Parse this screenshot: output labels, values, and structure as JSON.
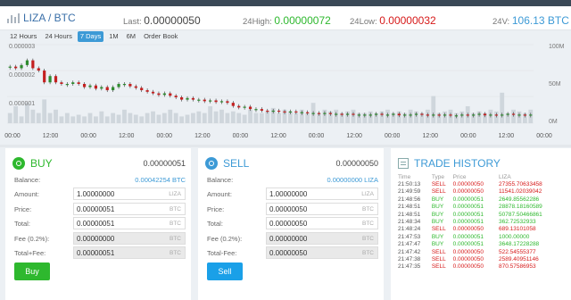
{
  "colors": {
    "buy": "#2eb82e",
    "sell": "#d61a1a",
    "accent": "#3d9ad6",
    "up_candle": "#2e8b2e",
    "down_candle": "#c42020",
    "volume": "#cfd6dc"
  },
  "header": {
    "pair": "LIZA / BTC",
    "last_label": "Last:",
    "last_value": "0.00000050",
    "high_label": "24High:",
    "high_value": "0.00000072",
    "low_label": "24Low:",
    "low_value": "0.00000032",
    "vol_label": "24V:",
    "vol_value": "106.13 BTC"
  },
  "tabs": [
    "12 Hours",
    "24 Hours",
    "7 Days",
    "1M",
    "6M",
    "Order Book"
  ],
  "active_tab": "7 Days",
  "chart_data": {
    "type": "candlestick",
    "y_ticks_left": [
      "0.000003",
      "0.000002",
      "0.000001"
    ],
    "y_ticks_right": [
      "100M",
      "50M",
      "0M"
    ],
    "x_ticks": [
      "00:00",
      "12:00",
      "00:00",
      "12:00",
      "00:00",
      "12:00",
      "00:00",
      "12:00",
      "00:00",
      "12:00",
      "00:00",
      "12:00",
      "00:00",
      "12:00",
      "00:00"
    ],
    "candle_levels": [
      0.72,
      0.7,
      0.74,
      0.8,
      0.7,
      0.67,
      0.52,
      0.6,
      0.52,
      0.5,
      0.5,
      0.52,
      0.5,
      0.46,
      0.48,
      0.44,
      0.46,
      0.42,
      0.46,
      0.5,
      0.5,
      0.47,
      0.45,
      0.42,
      0.4,
      0.38,
      0.36,
      0.38,
      0.35,
      0.33,
      0.3,
      0.32,
      0.3,
      0.3,
      0.28,
      0.29,
      0.27,
      0.28,
      0.26,
      0.22,
      0.2,
      0.21,
      0.18,
      0.18,
      0.16,
      0.15,
      0.16,
      0.15,
      0.14,
      0.15,
      0.14,
      0.14,
      0.13,
      0.13,
      0.12,
      0.13,
      0.12,
      0.12,
      0.11,
      0.12,
      0.11,
      0.11,
      0.11,
      0.11,
      0.12,
      0.11,
      0.11,
      0.12,
      0.1,
      0.11,
      0.11,
      0.12,
      0.11,
      0.1,
      0.11,
      0.1,
      0.11,
      0.1,
      0.1,
      0.11,
      0.1,
      0.11,
      0.12,
      0.1,
      0.11,
      0.1,
      0.11,
      0.12,
      0.11,
      0.11,
      0.1,
      0.11
    ],
    "volume_levels": [
      0.3,
      0.5,
      0.2,
      0.6,
      0.4,
      0.3,
      0.7,
      0.3,
      0.4,
      0.2,
      0.3,
      0.2,
      0.25,
      0.2,
      0.3,
      0.2,
      0.35,
      0.2,
      0.3,
      0.25,
      0.4,
      0.3,
      0.25,
      0.2,
      0.3,
      0.35,
      0.25,
      0.3,
      0.4,
      0.3,
      0.2,
      0.25,
      0.3,
      0.35,
      0.3,
      0.5,
      0.35,
      0.4,
      0.3,
      0.35,
      0.3,
      0.25,
      0.4,
      0.3,
      0.3,
      0.35,
      0.45,
      0.3,
      0.4,
      0.35,
      0.3,
      0.4,
      0.3,
      0.6,
      0.3,
      0.4,
      0.35,
      0.4,
      0.3,
      0.35,
      0.4,
      0.3,
      0.3,
      0.35,
      0.3,
      0.35,
      0.4,
      0.3,
      0.35,
      0.3,
      0.4,
      0.35,
      0.3,
      0.4,
      0.8,
      0.3,
      0.35,
      0.4,
      0.3,
      0.35,
      0.5,
      0.3,
      0.35,
      0.3,
      0.4,
      0.35,
      0.9,
      0.3,
      0.4,
      0.35,
      0.3,
      0.4
    ]
  },
  "buy": {
    "title": "BUY",
    "price": "0.00000051",
    "balance_label": "Balance:",
    "balance_value": "0.00042254 BTC",
    "fields": [
      {
        "label": "Amount:",
        "value": "1.00000000",
        "unit": "LIZA",
        "ro": false
      },
      {
        "label": "Price:",
        "value": "0.00000051",
        "unit": "BTC",
        "ro": false
      },
      {
        "label": "Total:",
        "value": "0.00000051",
        "unit": "BTC",
        "ro": false
      },
      {
        "label": "Fee (0.2%):",
        "value": "0.00000000",
        "unit": "BTC",
        "ro": true
      },
      {
        "label": "Total+Fee:",
        "value": "0.00000051",
        "unit": "BTC",
        "ro": true
      }
    ],
    "button": "Buy"
  },
  "sell": {
    "title": "SELL",
    "price": "0.00000050",
    "balance_label": "Balance:",
    "balance_value": "0.00000000 LIZA",
    "fields": [
      {
        "label": "Amount:",
        "value": "1.00000000",
        "unit": "LIZA",
        "ro": false
      },
      {
        "label": "Price:",
        "value": "0.00000050",
        "unit": "BTC",
        "ro": false
      },
      {
        "label": "Total:",
        "value": "0.00000050",
        "unit": "BTC",
        "ro": false
      },
      {
        "label": "Fee (0.2%):",
        "value": "0.00000000",
        "unit": "BTC",
        "ro": true
      },
      {
        "label": "Total-Fee:",
        "value": "0.00000050",
        "unit": "BTC",
        "ro": true
      }
    ],
    "button": "Sell"
  },
  "history": {
    "title": "TRADE HISTORY",
    "columns": [
      "Time",
      "Type",
      "Price",
      "LIZA"
    ],
    "rows": [
      {
        "time": "21:50:13",
        "type": "SELL",
        "price": "0.00000050",
        "amount": "27355.70633458"
      },
      {
        "time": "21:49:59",
        "type": "SELL",
        "price": "0.00000050",
        "amount": "11541.02039042"
      },
      {
        "time": "21:48:56",
        "type": "BUY",
        "price": "0.00000051",
        "amount": "2649.85562286"
      },
      {
        "time": "21:48:51",
        "type": "BUY",
        "price": "0.00000051",
        "amount": "28878.18160589"
      },
      {
        "time": "21:48:51",
        "type": "BUY",
        "price": "0.00000051",
        "amount": "50787.50466861"
      },
      {
        "time": "21:48:34",
        "type": "BUY",
        "price": "0.00000051",
        "amount": "362.72532933"
      },
      {
        "time": "21:48:24",
        "type": "SELL",
        "price": "0.00000050",
        "amount": "689.13101058"
      },
      {
        "time": "21:47:53",
        "type": "BUY",
        "price": "0.00000051",
        "amount": "1000.00000"
      },
      {
        "time": "21:47:47",
        "type": "BUY",
        "price": "0.00000051",
        "amount": "3648.17228288"
      },
      {
        "time": "21:47:42",
        "type": "SELL",
        "price": "0.00000050",
        "amount": "522.54555377"
      },
      {
        "time": "21:47:38",
        "type": "SELL",
        "price": "0.00000050",
        "amount": "2589.40951146"
      },
      {
        "time": "21:47:35",
        "type": "SELL",
        "price": "0.00000050",
        "amount": "870.57586953"
      }
    ]
  }
}
